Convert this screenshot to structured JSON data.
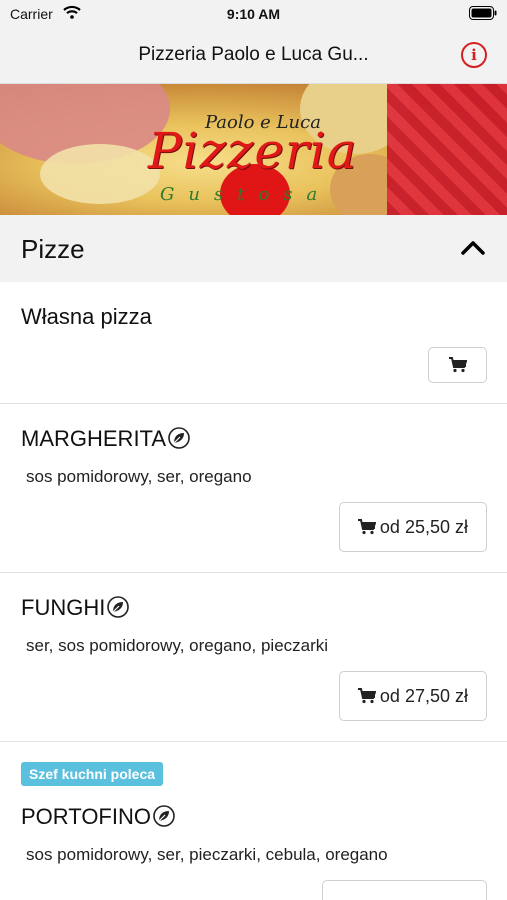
{
  "status_bar": {
    "carrier": "Carrier",
    "time": "9:10 AM"
  },
  "nav": {
    "title": "Pizzeria Paolo e Luca Gu...",
    "info_glyph": "i",
    "info_icon": "info-circle-icon",
    "accent": "#d32020"
  },
  "banner": {
    "logo_small": "Paolo e Luca",
    "logo_big": "Pizzeria",
    "logo_sub": "Gustosa"
  },
  "section": {
    "title": "Pizze"
  },
  "items": [
    {
      "name": "Własna pizza",
      "button_label": ""
    },
    {
      "name": "MARGHERITA",
      "description": "sos pomidorowy, ser, oregano",
      "button_label": "od 25,50 zł"
    },
    {
      "name": "FUNGHI",
      "description": "ser, sos pomidorowy, oregano, pieczarki",
      "button_label": "od 27,50 zł"
    },
    {
      "badge": "Szef kuchni poleca",
      "name": "PORTOFINO",
      "description": "sos pomidorowy, ser, pieczarki, cebula, oregano"
    }
  ],
  "colors": {
    "badge": "#5bc0de",
    "section_bg": "#f2f2f2"
  }
}
